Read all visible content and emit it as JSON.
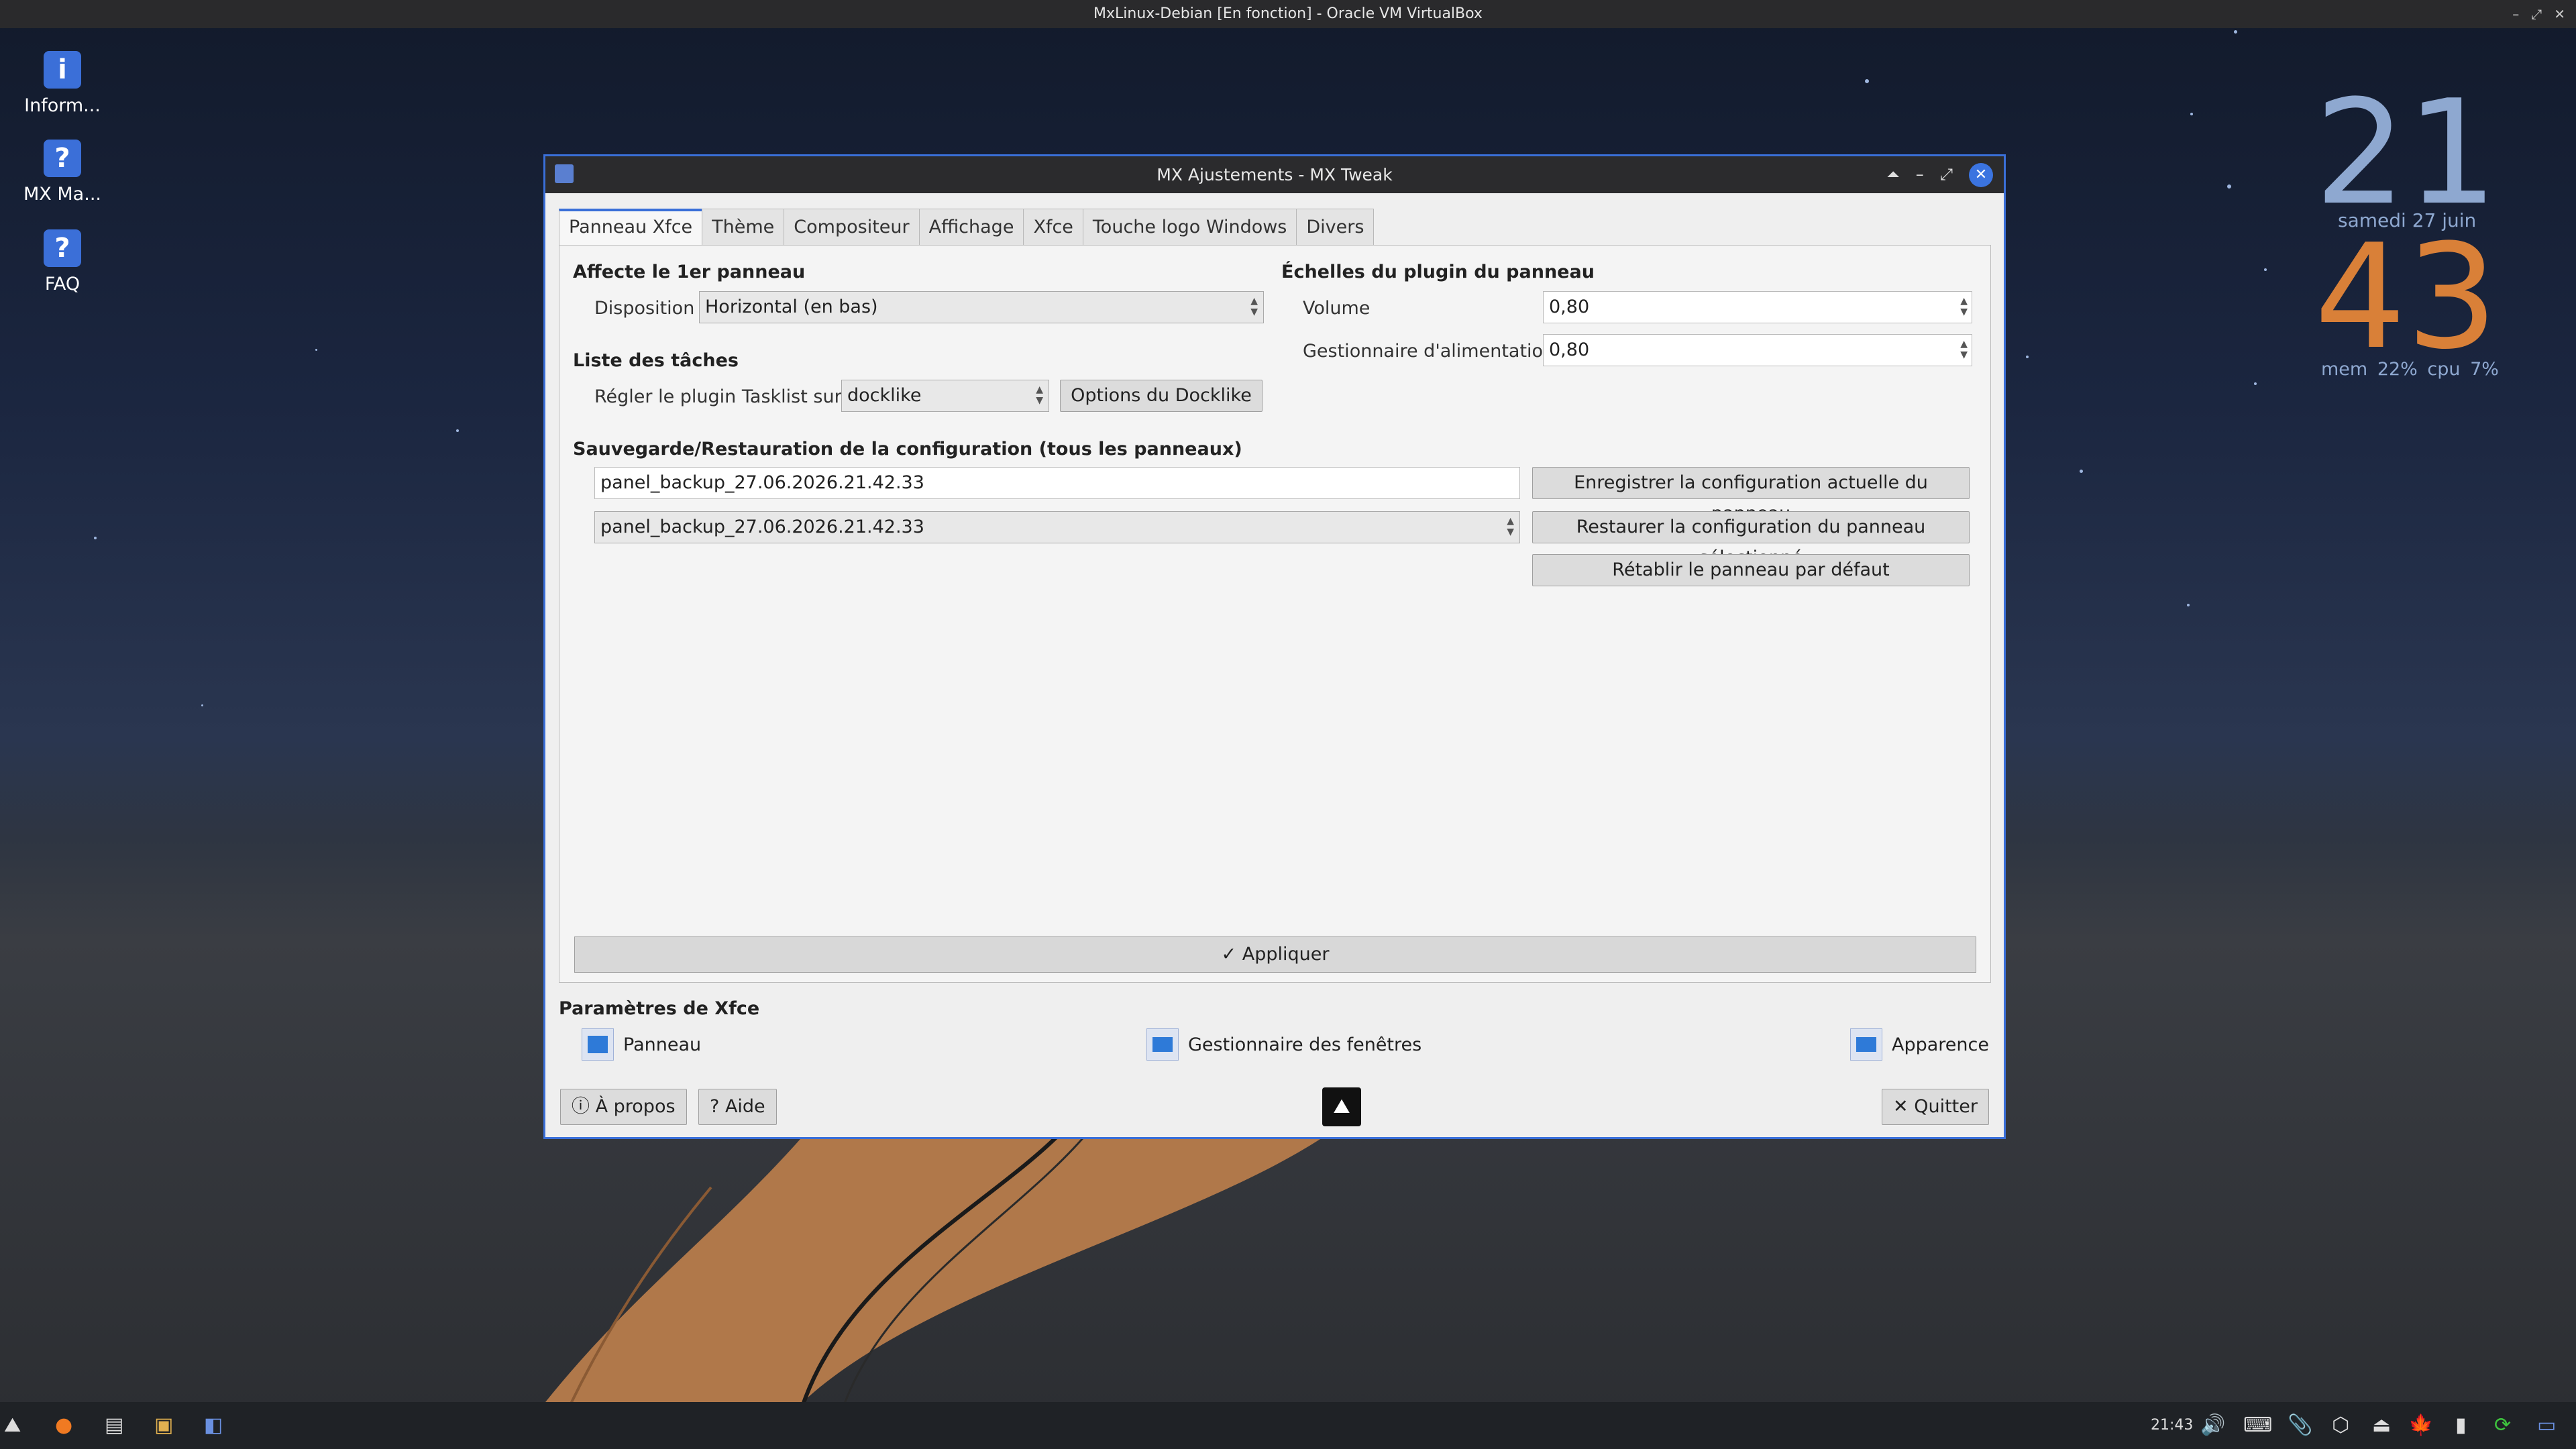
{
  "host": {
    "title": "MxLinux-Debian [En fonction] - Oracle VM VirtualBox"
  },
  "desktop_icons": [
    {
      "label": "Inform...",
      "icon": "info-icon"
    },
    {
      "label": "MX Ma...",
      "icon": "help-icon"
    },
    {
      "label": "FAQ",
      "icon": "help-icon"
    }
  ],
  "conky": {
    "hour": "21",
    "date": "samedi  27 juin",
    "minute": "43",
    "mem_label": "mem",
    "mem": "22%",
    "cpu_label": "cpu",
    "cpu": "7%"
  },
  "window": {
    "title": "MX Ajustements - MX Tweak",
    "tabs": [
      "Panneau Xfce",
      "Thème",
      "Compositeur",
      "Affichage",
      "Xfce",
      "Touche logo Windows",
      "Divers"
    ],
    "active_tab": "Panneau Xfce",
    "panel": {
      "affect_header": "Affecte le 1er panneau",
      "disposition_label": "Disposition",
      "disposition_value": "Horizontal (en bas)",
      "tasklist_header": "Liste des tâches",
      "tasklist_label": "Régler le plugin Tasklist sur :",
      "tasklist_value": "docklike",
      "docklike_options": "Options du Docklike",
      "scales_header": "Échelles du plugin du panneau",
      "volume_label": "Volume",
      "volume_value": "0,80",
      "power_label": "Gestionnaire d'alimentation",
      "power_value": "0,80",
      "backup_header": "Sauvegarde/Restauration de la configuration (tous les panneaux)",
      "backup_name": "panel_backup_27.06.2026.21.42.33",
      "save_button": "Enregistrer la configuration actuelle du panneau",
      "restore_select": "panel_backup_27.06.2026.21.42.33",
      "restore_button": "Restaurer la configuration du panneau sélectionné",
      "reset_button": "Rétablir le panneau par défaut",
      "apply_button": "Appliquer"
    },
    "xfce_params": {
      "header": "Paramètres de Xfce",
      "panneau": "Panneau",
      "wm": "Gestionnaire des fenêtres",
      "appearance": "Apparence"
    },
    "footer": {
      "about": "À propos",
      "help": "Aide",
      "quit": "Quitter"
    }
  },
  "taskbar": {
    "time": "21:43"
  }
}
